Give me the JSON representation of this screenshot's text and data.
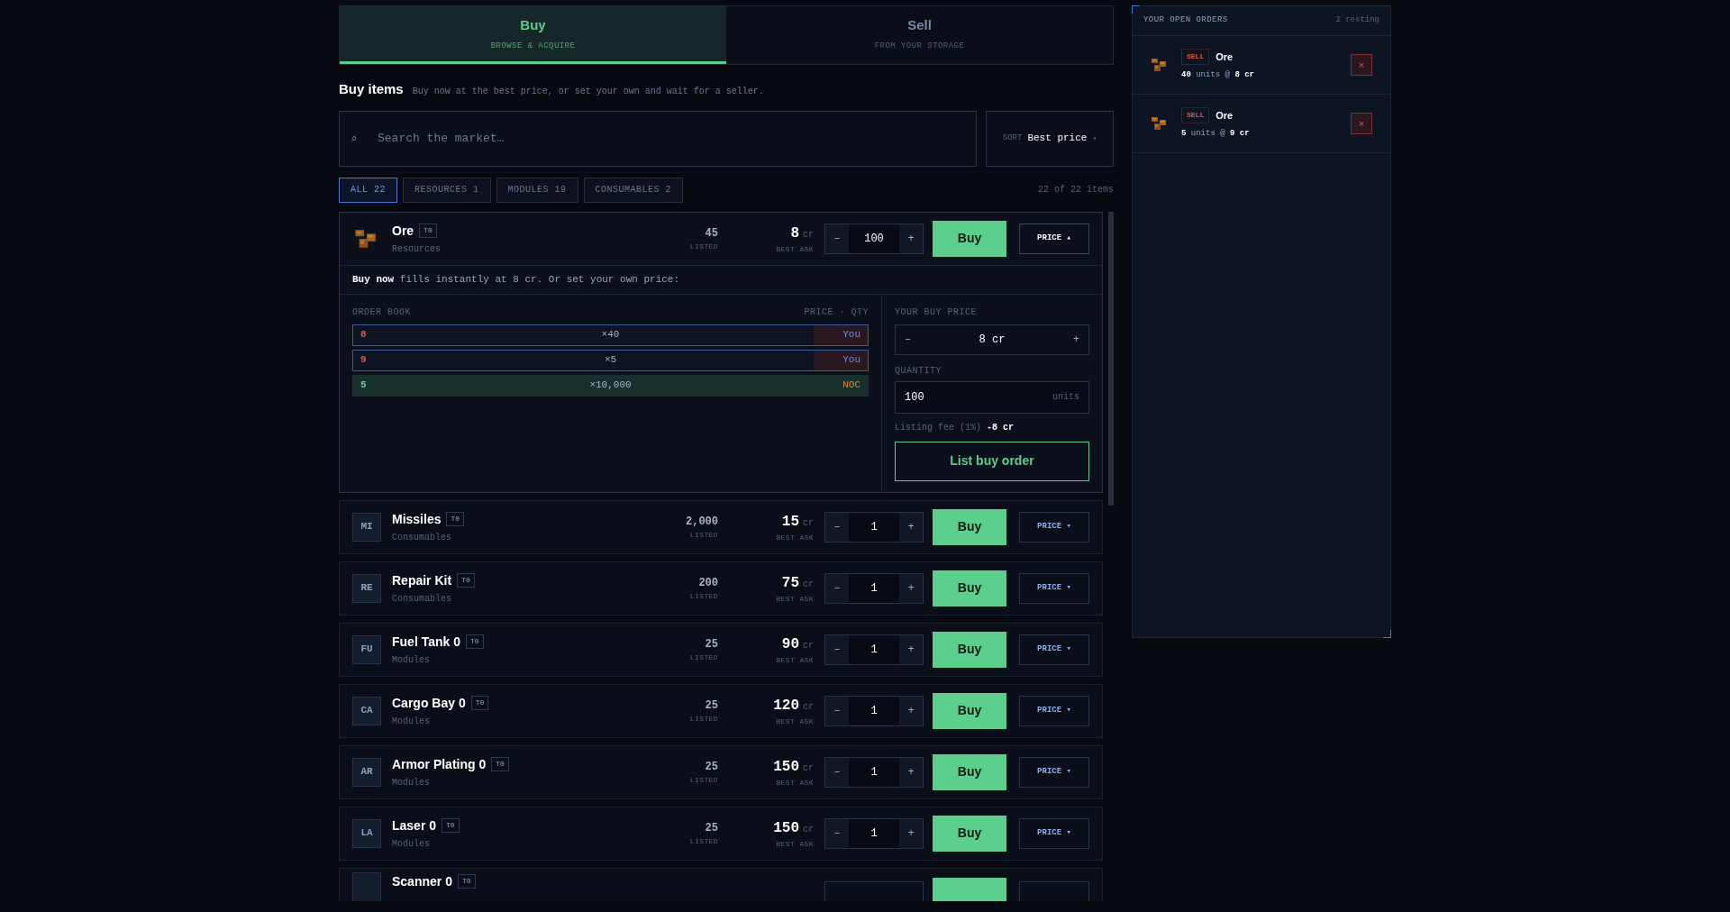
{
  "tabs": [
    {
      "label": "Buy",
      "sublabel": "BROWSE & ACQUIRE",
      "selected": true
    },
    {
      "label": "Sell",
      "sublabel": "FROM YOUR STORAGE",
      "selected": false
    }
  ],
  "header": {
    "title": "Buy items",
    "subtitle": "Buy now at the best price, or set your own and wait for a seller."
  },
  "search": {
    "icon": "⌕",
    "placeholder": "Search the market…"
  },
  "sort": {
    "label": "SORT",
    "value": "Best price",
    "caret": "▾"
  },
  "filters": [
    {
      "label": "ALL 22",
      "selected": true
    },
    {
      "label": "RESOURCES 1",
      "selected": false
    },
    {
      "label": "MODULES 19",
      "selected": false
    },
    {
      "label": "CONSUMABLES 2",
      "selected": false
    }
  ],
  "count": "22 of 22 items",
  "items": [
    {
      "kind": "ore",
      "name": "Ore",
      "tier": "T0",
      "category": "Resources",
      "listed": "45",
      "listed_label": "LISTED",
      "price": "8",
      "unit": "cr",
      "price_label": "BEST ASK",
      "minus": "–",
      "qty": "100",
      "plus": "+",
      "buy": "Buy",
      "toggle": "PRICE ▴",
      "expanded": true,
      "detail": {
        "note": "**Buy now** fills instantly at 8 cr. Or set your own price:",
        "book_title": "ORDER BOOK",
        "book_columns": "PRICE · QTY",
        "book": [
          {
            "kind": "own",
            "price": "8",
            "qty": "×40",
            "owner": "You"
          },
          {
            "kind": "own",
            "price": "9",
            "qty": "×5",
            "owner": "You"
          },
          {
            "kind": "npc",
            "price": "5",
            "qty": "×10,000",
            "owner": "NOC"
          }
        ],
        "price_label": "YOUR BUY PRICE",
        "price_minus": "–",
        "price_value": "8 cr",
        "price_plus": "+",
        "quantity_label": "QUANTITY",
        "quantity": "100",
        "quantity_unit": "units",
        "fee": "Listing fee (1%) **-8 cr**",
        "submit": "List buy order"
      }
    },
    {
      "kind": "initials",
      "initials": "MI",
      "name": "Missiles",
      "tier": "T0",
      "category": "Consumables",
      "listed": "2,000",
      "listed_label": "LISTED",
      "price": "15",
      "unit": "cr",
      "price_label": "BEST ASK",
      "minus": "–",
      "qty": "1",
      "plus": "+",
      "buy": "Buy",
      "toggle": "PRICE ▾",
      "expanded": false
    },
    {
      "kind": "initials",
      "initials": "RE",
      "name": "Repair Kit",
      "tier": "T0",
      "category": "Consumables",
      "listed": "200",
      "listed_label": "LISTED",
      "price": "75",
      "unit": "cr",
      "price_label": "BEST ASK",
      "minus": "–",
      "qty": "1",
      "plus": "+",
      "buy": "Buy",
      "toggle": "PRICE ▾",
      "expanded": false
    },
    {
      "kind": "initials",
      "initials": "FU",
      "name": "Fuel Tank 0",
      "tier": "T0",
      "category": "Modules",
      "listed": "25",
      "listed_label": "LISTED",
      "price": "90",
      "unit": "cr",
      "price_label": "BEST ASK",
      "minus": "–",
      "qty": "1",
      "plus": "+",
      "buy": "Buy",
      "toggle": "PRICE ▾",
      "expanded": false
    },
    {
      "kind": "initials",
      "initials": "CA",
      "name": "Cargo Bay 0",
      "tier": "T0",
      "category": "Modules",
      "listed": "25",
      "listed_label": "LISTED",
      "price": "120",
      "unit": "cr",
      "price_label": "BEST ASK",
      "minus": "–",
      "qty": "1",
      "plus": "+",
      "buy": "Buy",
      "toggle": "PRICE ▾",
      "expanded": false
    },
    {
      "kind": "initials",
      "initials": "AR",
      "name": "Armor Plating 0",
      "tier": "T0",
      "category": "Modules",
      "listed": "25",
      "listed_label": "LISTED",
      "price": "150",
      "unit": "cr",
      "price_label": "BEST ASK",
      "minus": "–",
      "qty": "1",
      "plus": "+",
      "buy": "Buy",
      "toggle": "PRICE ▾",
      "expanded": false
    },
    {
      "kind": "initials",
      "initials": "LA",
      "name": "Laser 0",
      "tier": "T0",
      "category": "Modules",
      "listed": "25",
      "listed_label": "LISTED",
      "price": "150",
      "unit": "cr",
      "price_label": "BEST ASK",
      "minus": "–",
      "qty": "1",
      "plus": "+",
      "buy": "Buy",
      "toggle": "PRICE ▾",
      "expanded": false
    },
    {
      "kind": "partial",
      "name": "Scanner 0",
      "tier": "T0",
      "expanded": false
    }
  ],
  "orders": {
    "title": "YOUR OPEN ORDERS",
    "count": "2 resting",
    "items": [
      {
        "kind": "ore",
        "side": "SELL",
        "name": "Ore",
        "detail": "**40** units @ **8 cr**",
        "cancel": "×"
      },
      {
        "kind": "ore",
        "side": "SELL",
        "name": "Ore",
        "detail": "**5** units @ **9 cr**",
        "cancel": "×"
      }
    ]
  }
}
